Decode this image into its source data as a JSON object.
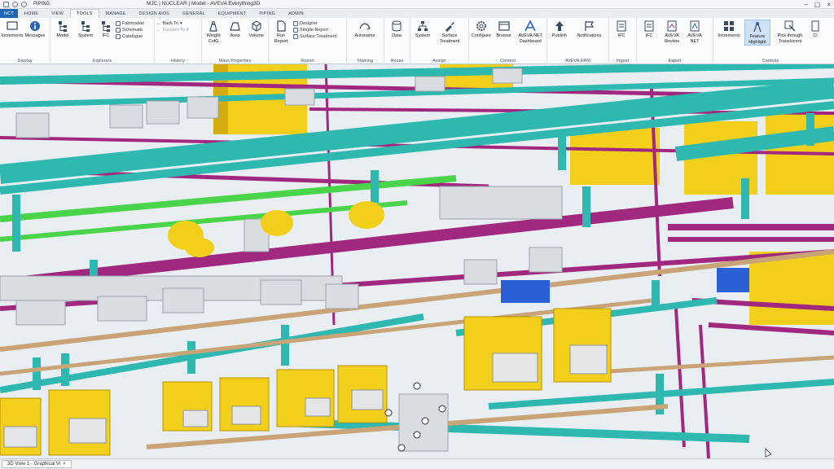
{
  "titlebar": {
    "quick_access_value": "PIPING",
    "title": "MJC | NUCLEAR | Model - AVEVA Everything3D"
  },
  "tabs": [
    "NCT",
    "HOME",
    "VIEW",
    "TOOLS",
    "MANAGE",
    "DESIGN AIDS",
    "GENERAL",
    "EQUIPMENT",
    "PIPING",
    "ADMIN"
  ],
  "ribbon": {
    "display": {
      "label": "Display",
      "buttons": [
        "Increments",
        "Messages"
      ]
    },
    "explorers": {
      "label": "Explorers",
      "buttons": [
        "Model",
        "System",
        "IFC"
      ],
      "small": [
        "Fabrication",
        "Schematic",
        "Catalogue"
      ]
    },
    "history": {
      "label": "History",
      "small": [
        "Back To",
        "Forward To"
      ]
    },
    "mass": {
      "label": "Mass Properties",
      "buttons": [
        "Weight CofG",
        "Area",
        "Volume"
      ]
    },
    "report": {
      "label": "Report",
      "buttons": [
        "Run Report"
      ],
      "small": [
        "Designer",
        "Simple Report",
        "Surface Treatment"
      ]
    },
    "naming": {
      "label": "Naming",
      "buttons": [
        "Autoname"
      ]
    },
    "reuse": {
      "label": "Reuse",
      "buttons": [
        "Data"
      ]
    },
    "assign": {
      "label": "Assign",
      "buttons": [
        "System",
        "Surface Treatment"
      ]
    },
    "context": {
      "label": "Context",
      "buttons": [
        "Configure",
        "Browse",
        "AVEVA NET Dashboard"
      ]
    },
    "erm": {
      "label": "AVEVA ERM",
      "buttons": [
        "Publish",
        "Notifications"
      ]
    },
    "import": {
      "label": "Import",
      "buttons": [
        "IFC"
      ]
    },
    "export": {
      "label": "Export",
      "buttons": [
        "IFC",
        "AVEVA Review",
        "AVEVA NET"
      ]
    },
    "controls": {
      "label": "Controls",
      "buttons": [
        "Increments",
        "Feature Highlight",
        "Pick through Translucent",
        "Cl"
      ]
    }
  },
  "statusbar": {
    "view_tab": "3D View 1 - Graphical Vi"
  },
  "colors": {
    "teal_pipe": "#2fb8b0",
    "magenta_pipe": "#a0287e",
    "green_pipe": "#4ad44a",
    "yellow_equipment": "#f2cf1a",
    "tan_pipe": "#c9a477",
    "grey_equipment": "#d9dde1",
    "blue_equipment": "#2a5fd6",
    "accent_blue": "#1f66b3"
  }
}
